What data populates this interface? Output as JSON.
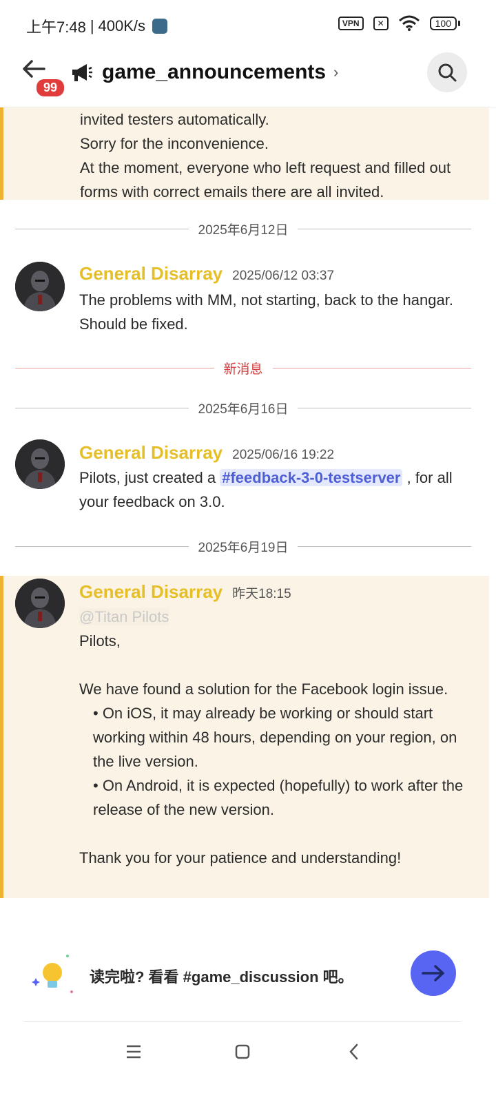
{
  "status_bar": {
    "time": "上午7:48",
    "net_speed": "400K/s",
    "vpn": "VPN",
    "battery": "100"
  },
  "header": {
    "channel_name": "game_announcements",
    "unread_count": "99"
  },
  "previous_message": {
    "lines": [
      "invited testers automatically.",
      "Sorry for the inconvenience.",
      "At the moment, everyone who left request and filled out forms with correct emails there are all invited."
    ]
  },
  "dividers": {
    "date1": "2025年6月12日",
    "new_messages": "新消息",
    "date2": "2025年6月16日",
    "date3": "2025年6月19日"
  },
  "messages": [
    {
      "author": "General Disarray",
      "timestamp": "2025/06/12 03:37",
      "text": "The problems with MM, not starting, back to the hangar. Should be fixed."
    },
    {
      "author": "General Disarray",
      "timestamp": "2025/06/16 19:22",
      "text_before": "Pilots, just created a ",
      "channel_mention": "#feedback-3-0-testserver",
      "text_after": " , for all your feedback on 3.0."
    },
    {
      "author": "General Disarray",
      "timestamp": "昨天18:15",
      "role_mention": "@Titan Pilots",
      "greeting": "Pilots,",
      "intro": "We have found a solution for the Facebook login issue.",
      "bullet1": "•   On iOS, it may already be working or should start working within 48 hours, depending on       your region, on the live version.",
      "bullet2": "•   On Android, it is expected (hopefully) to work after the release of the new version.",
      "closing": "Thank you for your patience and understanding!"
    }
  ],
  "next_prompt": {
    "text": "读完啦? 看看 #game_discussion 吧。"
  },
  "colors": {
    "accent": "#5865f2",
    "author": "#e6bf28",
    "highlight_bg": "#fbf4e6",
    "highlight_bar": "#f0b232",
    "badge": "#e03c3c"
  }
}
